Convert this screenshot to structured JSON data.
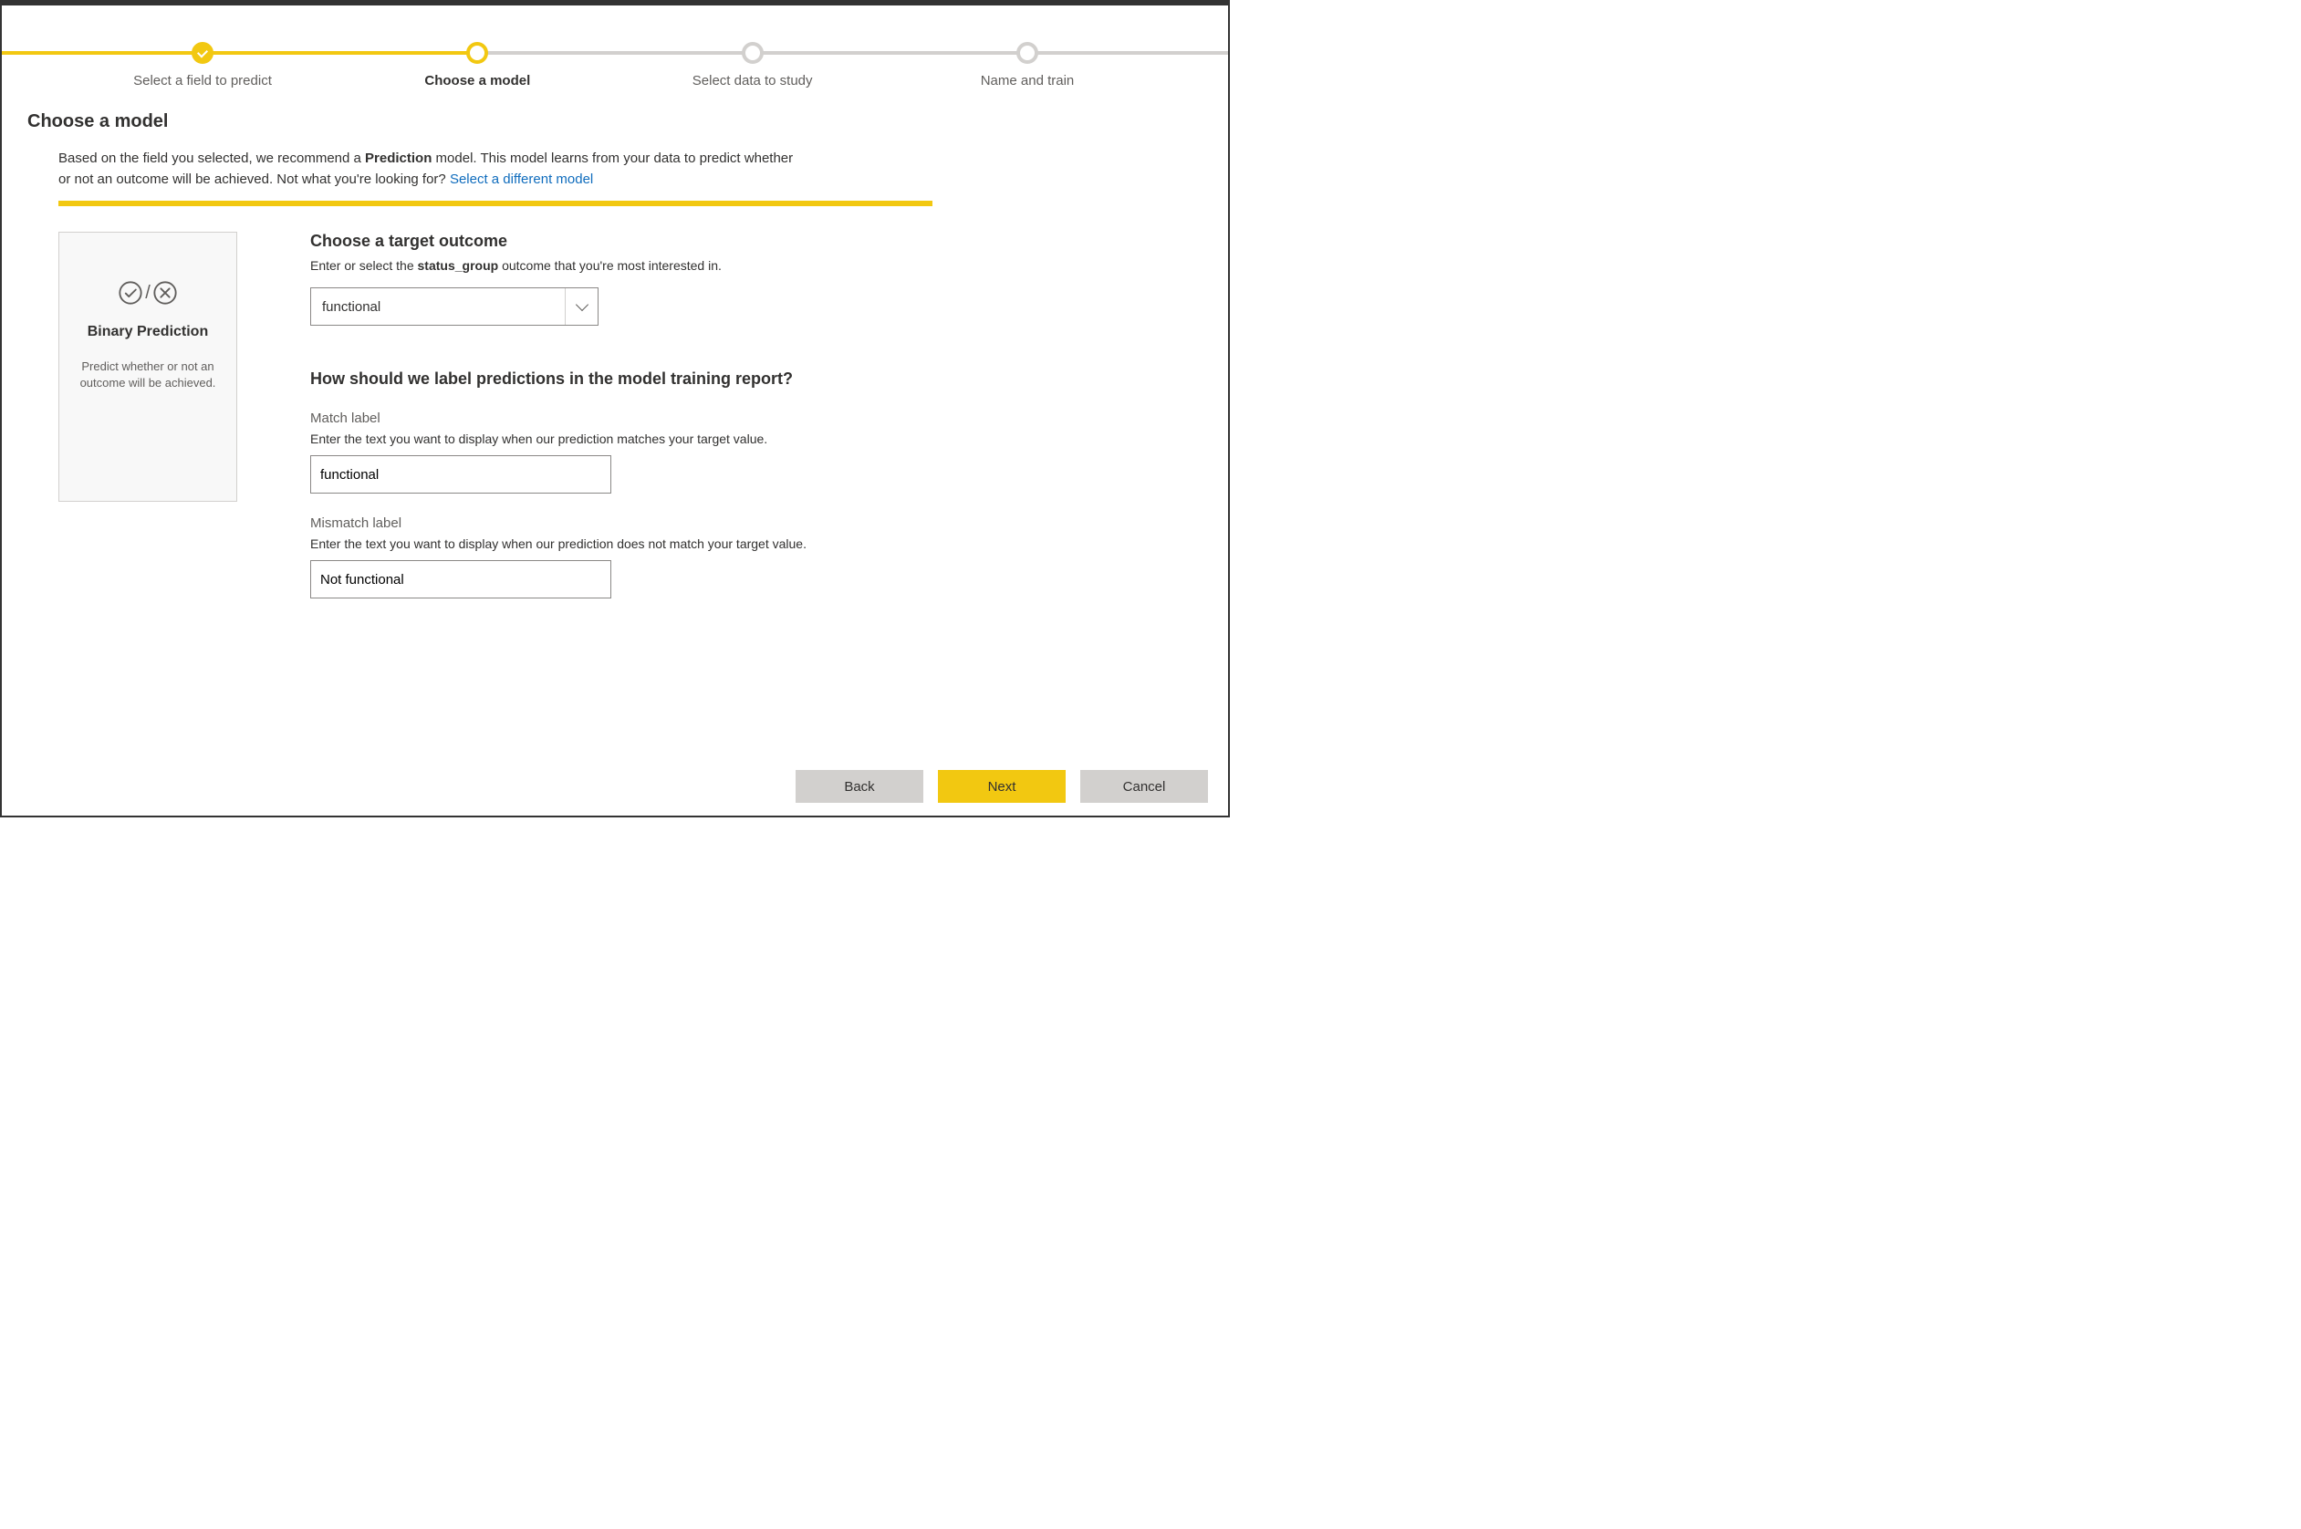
{
  "stepper": {
    "steps": [
      {
        "label": "Select a field to predict",
        "state": "done"
      },
      {
        "label": "Choose a model",
        "state": "current"
      },
      {
        "label": "Select data to study",
        "state": "todo"
      },
      {
        "label": "Name and train",
        "state": "todo"
      }
    ]
  },
  "page_title": "Choose a model",
  "intro": {
    "prefix": "Based on the field you selected, we recommend a ",
    "bold": "Prediction",
    "middle": " model. This model learns from your data to predict whether or not an outcome will be achieved. Not what you're looking for? ",
    "link": "Select a different model"
  },
  "card": {
    "title": "Binary Prediction",
    "desc": "Predict whether or not an outcome will be achieved.",
    "icon_name": "check-cross-icon"
  },
  "form": {
    "target_heading": "Choose a target outcome",
    "target_sub_pre": "Enter or select the ",
    "target_sub_bold": "status_group",
    "target_sub_post": " outcome that you're most interested in.",
    "target_value": "functional",
    "labels_heading": "How should we label predictions in the model training report?",
    "match": {
      "label": "Match label",
      "desc": "Enter the text you want to display when our prediction matches your target value.",
      "value": "functional"
    },
    "mismatch": {
      "label": "Mismatch label",
      "desc": "Enter the text you want to display when our prediction does not match your target value.",
      "value": "Not functional"
    }
  },
  "footer": {
    "back": "Back",
    "next": "Next",
    "cancel": "Cancel"
  },
  "colors": {
    "accent": "#F2C811",
    "link": "#0f6cbd"
  }
}
